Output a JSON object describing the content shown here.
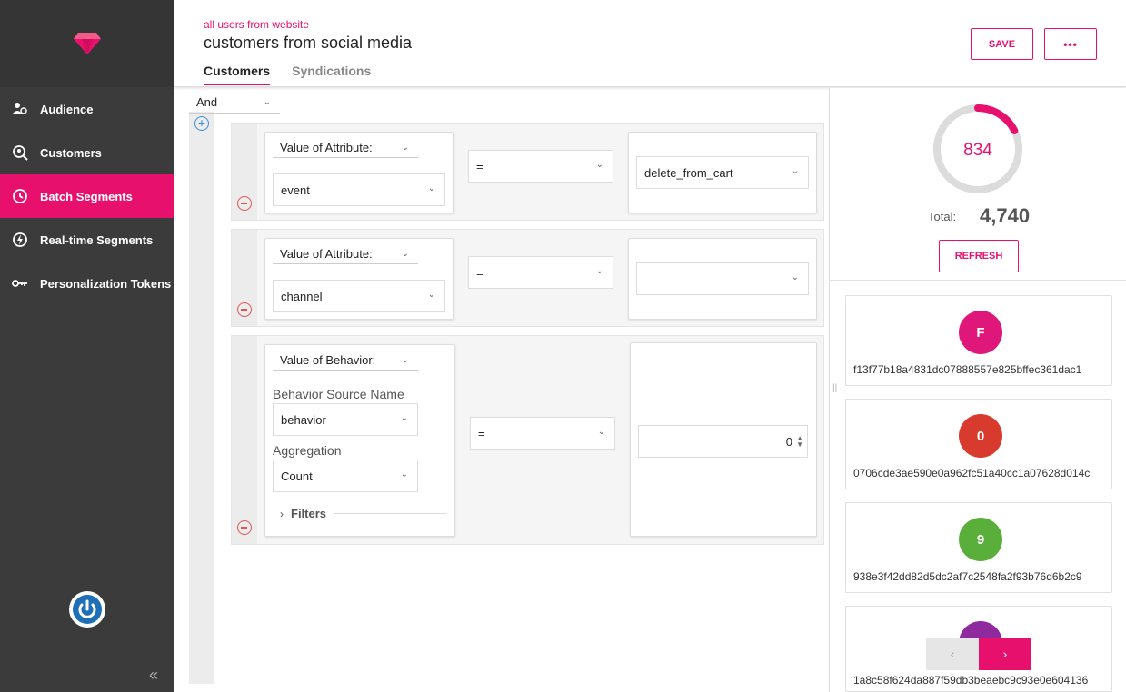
{
  "sidebar": {
    "items": [
      {
        "label": "Audience",
        "icon": "audience-icon",
        "active": false
      },
      {
        "label": "Customers",
        "icon": "customers-icon",
        "active": false
      },
      {
        "label": "Batch Segments",
        "icon": "batch-segments-icon",
        "active": true
      },
      {
        "label": "Real-time Segments",
        "icon": "realtime-segments-icon",
        "active": false
      },
      {
        "label": "Personalization Tokens",
        "icon": "key-icon",
        "active": false
      }
    ]
  },
  "header": {
    "breadcrumb": "all users from website",
    "title": "customers from social media",
    "tabs": [
      {
        "label": "Customers",
        "active": true
      },
      {
        "label": "Syndications",
        "active": false
      }
    ],
    "save_label": "SAVE",
    "more_label": "•••"
  },
  "builder": {
    "operator": "And",
    "rules": [
      {
        "kind_label": "Value of Attribute:",
        "attribute": "event",
        "comparator": "=",
        "value": "delete_from_cart"
      },
      {
        "kind_label": "Value of Attribute:",
        "attribute": "channel",
        "comparator": "=",
        "value": ""
      },
      {
        "kind_label": "Value of Behavior:",
        "source_label": "Behavior Source Name",
        "source_value": "behavior",
        "aggregation_label": "Aggregation",
        "aggregation_value": "Count",
        "filters_label": "Filters",
        "comparator": "=",
        "number_value": "0"
      }
    ]
  },
  "summary": {
    "matched": "834",
    "matched_fraction": 0.176,
    "total_label": "Total:",
    "total_value": "4,740",
    "refresh_label": "REFRESH"
  },
  "customers": [
    {
      "initial": "F",
      "id": "f13f77b18a4831dc07888557e825bffec361dac1",
      "color": "#e0177a"
    },
    {
      "initial": "0",
      "id": "0706cde3ae590e0a962fc51a40cc1a07628d014c",
      "color": "#d83a2e"
    },
    {
      "initial": "9",
      "id": "938e3f42dd82d5dc2af7c2548fa2f93b76d6b2c9",
      "color": "#5aae3a"
    },
    {
      "initial": "1",
      "id": "1a8c58f624da887f59db3beaebc9c93e0e604136",
      "color": "#8e2a9e"
    }
  ],
  "pager": {
    "prev": "‹",
    "next": "›"
  },
  "colors": {
    "accent": "#e8106d",
    "sidebar": "#3b3b3b",
    "add": "#3b8fd8",
    "remove": "#e05555"
  }
}
